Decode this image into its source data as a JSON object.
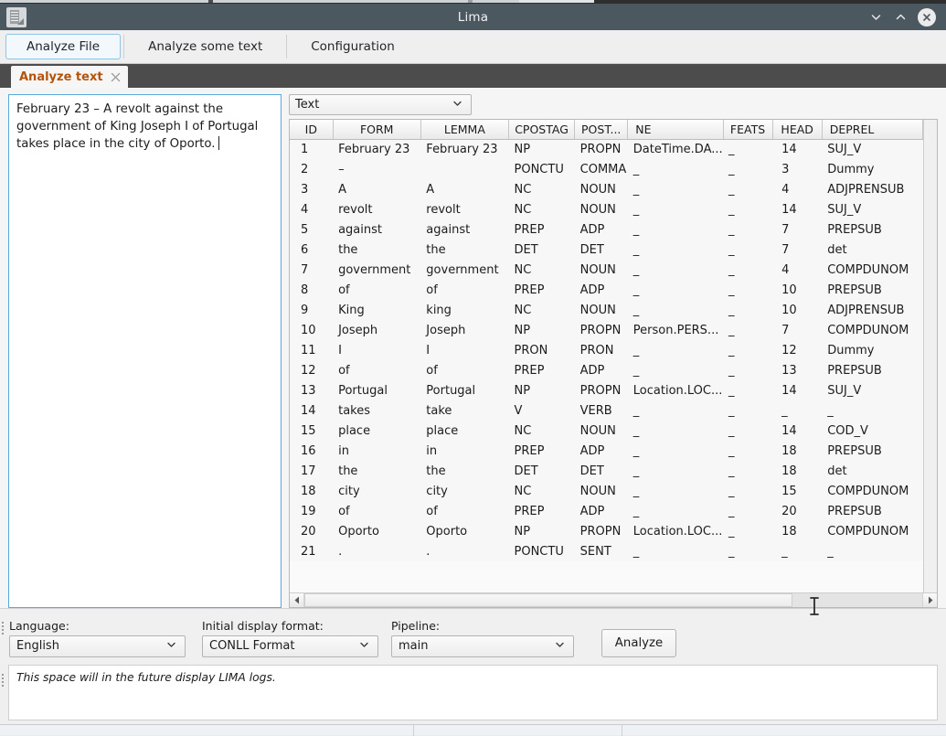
{
  "window": {
    "title": "Lima",
    "app_icon": "document-icon",
    "controls": [
      {
        "name": "minimize-button",
        "glyph": "chevron-down-icon"
      },
      {
        "name": "maximize-button",
        "glyph": "chevron-up-icon"
      },
      {
        "name": "close-button",
        "glyph": "close-icon"
      }
    ]
  },
  "toolbar": {
    "tabs": [
      {
        "label": "Analyze File",
        "active": true
      },
      {
        "label": "Analyze some text",
        "active": false
      },
      {
        "label": "Configuration",
        "active": false
      }
    ]
  },
  "doc_tab": {
    "label": "Analyze text",
    "close_icon": "close-icon"
  },
  "editor": {
    "text": "February 23 – A revolt against the government of King Joseph I of Portugal takes place in the city of Oporto.",
    "caret_visible": true
  },
  "format_select": {
    "value": "Text",
    "chevron": "chevron-down-icon"
  },
  "table": {
    "columns": [
      "ID",
      "FORM",
      "LEMMA",
      "CPOSTAG",
      "POST...",
      "NE",
      "FEATS",
      "HEAD",
      "DEPREL"
    ],
    "rows": [
      [
        "1",
        "February 23",
        "February 23",
        "NP",
        "PROPN",
        "DateTime.DA...",
        "_",
        "14",
        "SUJ_V"
      ],
      [
        "2",
        "–",
        "",
        "PONCTU",
        "COMMA",
        "_",
        "_",
        "3",
        "Dummy"
      ],
      [
        "3",
        "A",
        "A",
        "NC",
        "NOUN",
        "_",
        "_",
        "4",
        "ADJPRENSUB"
      ],
      [
        "4",
        "revolt",
        "revolt",
        "NC",
        "NOUN",
        "_",
        "_",
        "14",
        "SUJ_V"
      ],
      [
        "5",
        "against",
        "against",
        "PREP",
        "ADP",
        "_",
        "_",
        "7",
        "PREPSUB"
      ],
      [
        "6",
        "the",
        "the",
        "DET",
        "DET",
        "_",
        "_",
        "7",
        "det"
      ],
      [
        "7",
        "government",
        "government",
        "NC",
        "NOUN",
        "_",
        "_",
        "4",
        "COMPDUNOM"
      ],
      [
        "8",
        "of",
        "of",
        "PREP",
        "ADP",
        "_",
        "_",
        "10",
        "PREPSUB"
      ],
      [
        "9",
        "King",
        "king",
        "NC",
        "NOUN",
        "_",
        "_",
        "10",
        "ADJPRENSUB"
      ],
      [
        "10",
        "Joseph",
        "Joseph",
        "NP",
        "PROPN",
        "Person.PERS...",
        "_",
        "7",
        "COMPDUNOM"
      ],
      [
        "11",
        "I",
        "I",
        "PRON",
        "PRON",
        "_",
        "_",
        "12",
        "Dummy"
      ],
      [
        "12",
        "of",
        "of",
        "PREP",
        "ADP",
        "_",
        "_",
        "13",
        "PREPSUB"
      ],
      [
        "13",
        "Portugal",
        "Portugal",
        "NP",
        "PROPN",
        "Location.LOC...",
        "_",
        "14",
        "SUJ_V"
      ],
      [
        "14",
        "takes",
        "take",
        "V",
        "VERB",
        "_",
        "_",
        "_",
        "_"
      ],
      [
        "15",
        "place",
        "place",
        "NC",
        "NOUN",
        "_",
        "_",
        "14",
        "COD_V"
      ],
      [
        "16",
        "in",
        "in",
        "PREP",
        "ADP",
        "_",
        "_",
        "18",
        "PREPSUB"
      ],
      [
        "17",
        "the",
        "the",
        "DET",
        "DET",
        "_",
        "_",
        "18",
        "det"
      ],
      [
        "18",
        "city",
        "city",
        "NC",
        "NOUN",
        "_",
        "_",
        "15",
        "COMPDUNOM"
      ],
      [
        "19",
        "of",
        "of",
        "PREP",
        "ADP",
        "_",
        "_",
        "20",
        "PREPSUB"
      ],
      [
        "20",
        "Oporto",
        "Oporto",
        "NP",
        "PROPN",
        "Location.LOC...",
        "_",
        "18",
        "COMPDUNOM"
      ],
      [
        "21",
        ".",
        ".",
        "PONCTU",
        "SENT",
        "_",
        "_",
        "_",
        "_"
      ]
    ]
  },
  "controls": {
    "language": {
      "label": "Language:",
      "value": "English"
    },
    "display_format": {
      "label": "Initial display format:",
      "value": "CONLL Format"
    },
    "pipeline": {
      "label": "Pipeline:",
      "value": "main"
    },
    "analyze_button": "Analyze"
  },
  "log": {
    "text": "This space will in the future display LIMA logs."
  },
  "colors": {
    "titlebar": "#4c585f",
    "doc_tab_bar": "#4c4c4c",
    "doc_tab_label": "#b45309",
    "focus_border": "#5aa9dd",
    "body_bg": "#f5f5f5"
  }
}
